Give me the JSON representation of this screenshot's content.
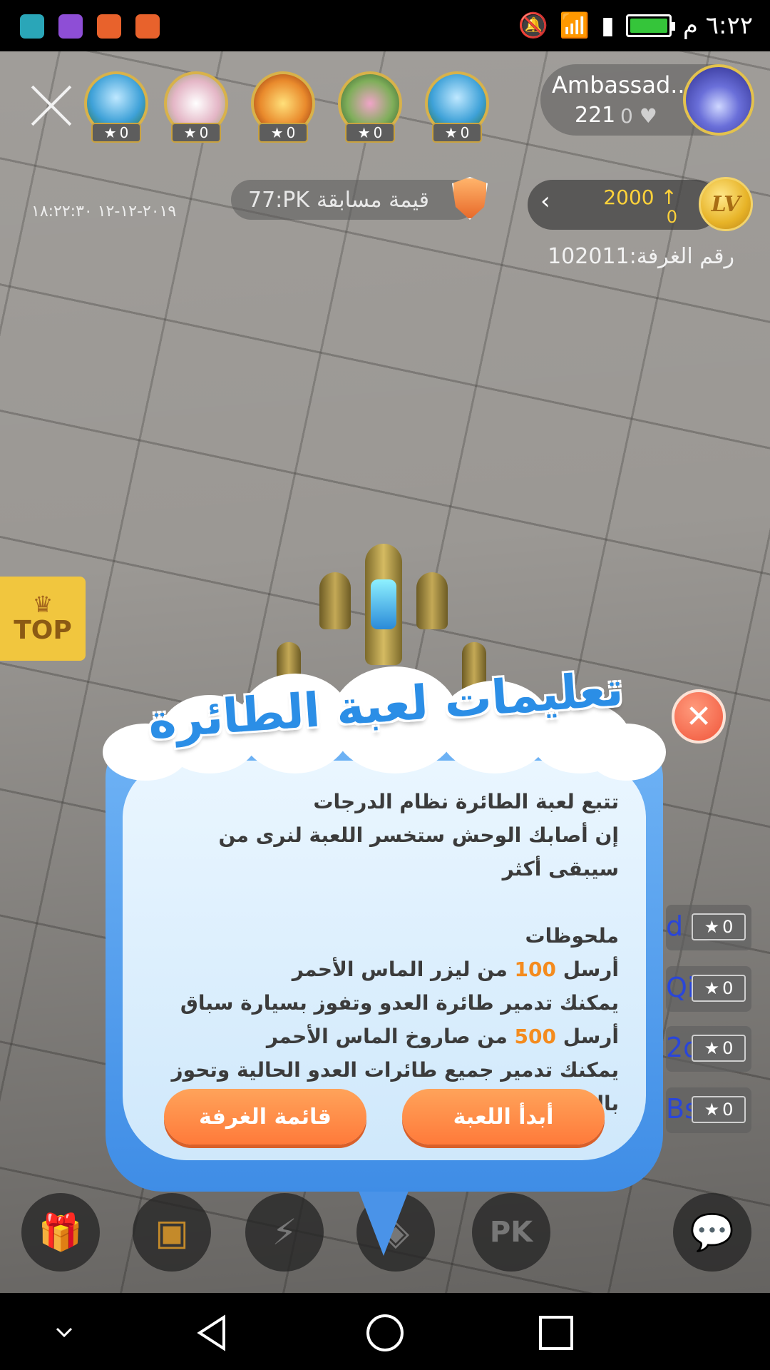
{
  "status_bar": {
    "time": "٦:٢٢ م",
    "app_icons": [
      {
        "name": "android-debug-icon",
        "color": "#2aa6b8"
      },
      {
        "name": "gallery-icon",
        "color": "#8e4ed6"
      },
      {
        "name": "music-icon",
        "color": "#e8622c"
      },
      {
        "name": "music-icon-2",
        "color": "#e8622c"
      }
    ]
  },
  "room": {
    "host_name": "Ambassad...",
    "host_count": "221",
    "host_likes": "0",
    "pk_label": "قيمة مسابقة",
    "pk_value": "77:PK",
    "datetime": "٢٠١٩-١٢-١٢ ١٨:٢٢:٣٠",
    "level_up_value": "2000",
    "level_sub_value": "0",
    "level_badge": "LV",
    "room_number_label": "رقم الغرفة:102011",
    "top_label": "TOP",
    "viewers": [
      {
        "badge": "0",
        "color": "#3ea1d8"
      },
      {
        "badge": "0",
        "color": "#e4b6c6"
      },
      {
        "badge": "0",
        "color": "#e98a2c"
      },
      {
        "badge": "0",
        "color": "#7fae5a"
      },
      {
        "badge": "0",
        "color": "#3ea1d8"
      }
    ],
    "chat_rows": [
      {
        "letter": "d",
        "badge": "0"
      },
      {
        "letter": "Qi",
        "badge": "0"
      },
      {
        "letter": "2d",
        "badge": "0"
      },
      {
        "letter": "Bs",
        "badge": "0"
      }
    ]
  },
  "dialog": {
    "title": "تعليمات لعبة الطائرة",
    "line1": "تتبع لعبة الطائرة نظام الدرجات",
    "line2": "إن أصابك الوحش ستخسر اللعبة لنرى من سيبقى أكثر",
    "notes_heading": "ملحوظات",
    "note1_prefix": "أرسل",
    "note1_amount": "100",
    "note1_suffix": "من ليزر الماس الأحمر",
    "note1_desc": "يمكنك تدمير طائرة العدو وتفوز بسيارة سباق",
    "note2_prefix": "أرسل",
    "note2_amount": "500",
    "note2_suffix": "من صاروخ الماس الأحمر",
    "note2_desc": "يمكنك تدمير جميع طائرات العدو الحالية وتحوز بالبركان",
    "room_list_button": "قائمة الغرفة",
    "start_game_button": "أبدأ اللعبة"
  },
  "bottom_bar": [
    "gift-icon",
    "treasure-icon",
    "camera-flash-icon",
    "game-icon",
    "pk-icon",
    "chat-bubble-icon"
  ],
  "colors": {
    "accent_orange": "#ff8a45",
    "dialog_blue": "#3f8de6",
    "gold": "#e7b327"
  }
}
